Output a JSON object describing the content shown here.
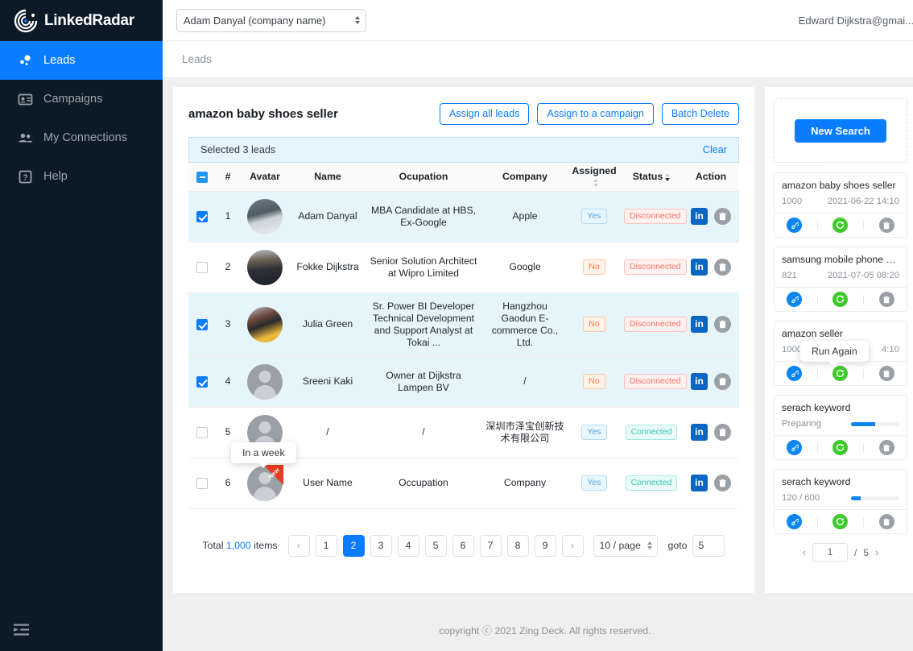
{
  "brand": {
    "name": "LinkedRadar",
    "logo_icon": "radar-logo-icon"
  },
  "sidebar": {
    "items": [
      {
        "label": "Leads",
        "icon": "leads-icon",
        "active": true
      },
      {
        "label": "Campaigns",
        "icon": "campaigns-icon",
        "active": false
      },
      {
        "label": "My Connections",
        "icon": "connections-icon",
        "active": false
      },
      {
        "label": "Help",
        "icon": "help-icon",
        "active": false
      }
    ],
    "collapse_icon": "collapse-sidebar-icon"
  },
  "topbar": {
    "account_select_value": "Adam Danyal  (company name)",
    "user_email": "Edward Dijkstra@gmai..."
  },
  "breadcrumb": {
    "text": "Leads"
  },
  "main": {
    "title": "amazon baby shoes seller",
    "buttons": {
      "assign_all": "Assign all leads",
      "assign_campaign": "Assign to a campaign",
      "batch_delete": "Batch Delete"
    },
    "selection_bar": {
      "text": "Selected 3 leads",
      "clear_label": "Clear"
    },
    "table": {
      "headers": [
        "#",
        "Avatar",
        "Name",
        "Ocupation",
        "Company",
        "Assigned",
        "Status",
        "Action"
      ],
      "header_checkbox_state": "indeterminate",
      "rows": [
        {
          "num": "1",
          "selected": true,
          "avatar": "photo-man-mask",
          "name": "Adam Danyal",
          "occupation": "MBA Candidate at HBS, Ex-Google",
          "company": "Apple",
          "assigned": "Yes",
          "status": "Disconnected"
        },
        {
          "num": "2",
          "selected": false,
          "avatar": "photo-man-suit",
          "name": "Fokke Dijkstra",
          "occupation": "Senior Solution Architect at Wipro Limited",
          "company": "Google",
          "assigned": "No",
          "status": "Disconnected"
        },
        {
          "num": "3",
          "selected": true,
          "avatar": "photo-woman-yellow",
          "name": "Julia Green",
          "occupation": "Sr. Power BI Developer Technical Development and Support Analyst at Tokai  ...",
          "company": "Hangzhou Gaodun E-commerce Co., Ltd.",
          "assigned": "No",
          "status": "Disconnected"
        },
        {
          "num": "4",
          "selected": true,
          "avatar": "placeholder",
          "name": "Sreeni Kaki",
          "occupation": "Owner at Dijkstra Lampen BV",
          "company": "/",
          "assigned": "No",
          "status": "Disconnected"
        },
        {
          "num": "5",
          "selected": false,
          "avatar": "placeholder",
          "name": "/",
          "occupation": "/",
          "company": "深圳市泽宝创新技术有限公司",
          "assigned": "Yes",
          "status": "Connected"
        },
        {
          "num": "6",
          "selected": false,
          "avatar": "placeholder",
          "name": "User Name",
          "occupation": "Occupation",
          "company": "Company",
          "assigned": "Yes",
          "status": "Connected",
          "badge": "New"
        }
      ],
      "action_icons": [
        "linkedin-icon",
        "delete-icon"
      ]
    },
    "tooltip_table": "In a week",
    "pagination": {
      "total_prefix": "Total",
      "total_count": "1,000",
      "total_suffix": "items",
      "prev_icon": "chevron-left-icon",
      "next_icon": "chevron-right-icon",
      "pages": [
        "1",
        "2",
        "3",
        "4",
        "5",
        "6",
        "7",
        "8",
        "9"
      ],
      "current_page": "2",
      "page_size": "10 / page",
      "goto_label": "goto",
      "goto_value": "5"
    }
  },
  "side_panel": {
    "new_search_label": "New Search",
    "tooltip_run_again": "Run Again",
    "cards": [
      {
        "title": "amazon baby shoes seller",
        "count": "1000",
        "date": "2021-06-22 14:10",
        "progress": null
      },
      {
        "title": "samsung mobile phone XX...",
        "count": "821",
        "date": "2021-07-05 08:20",
        "progress": null
      },
      {
        "title": "amazon seller",
        "count": "1000",
        "date": "4:10",
        "progress": null
      },
      {
        "title": "serach keyword",
        "count": "Preparing",
        "date": "",
        "progress": 50
      },
      {
        "title": "serach keyword",
        "count": "120 / 600",
        "date": "",
        "progress": 20
      }
    ],
    "card_icons": [
      "link-icon",
      "run-again-icon",
      "delete-icon"
    ],
    "pager": {
      "prev_icon": "chevron-left-icon",
      "page": "1",
      "sep": "/",
      "total": "5",
      "next_icon": "chevron-right-icon"
    }
  },
  "footer": {
    "text": "copyright ⓒ 2021 Zing Deck. All rights reserved."
  },
  "colors": {
    "accent": "#0a7cff",
    "sidebar_bg": "#0b1a26",
    "selected_row": "#e6f4fc",
    "green": "#3ec92a",
    "red_badge": "#ec3b24"
  }
}
